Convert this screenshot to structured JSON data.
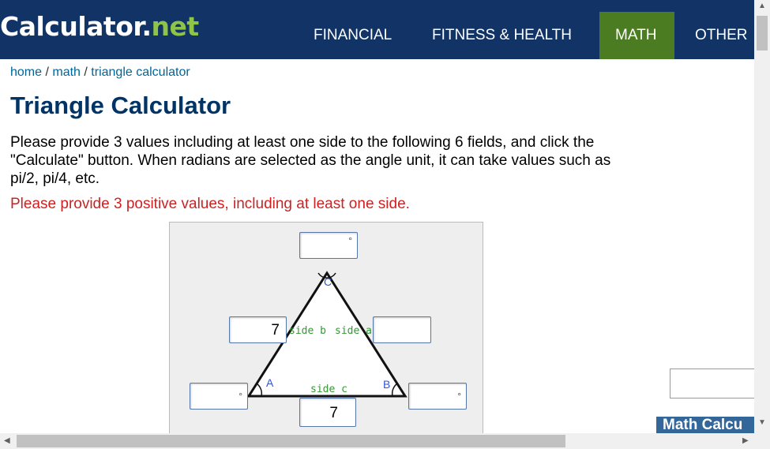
{
  "header": {
    "logo_calc": "Calculator",
    "logo_dot": ".",
    "logo_net": "net",
    "nav": [
      "FINANCIAL",
      "FITNESS & HEALTH",
      "MATH",
      "OTHER"
    ]
  },
  "breadcrumb": {
    "home": "home",
    "sep": " / ",
    "math": "math",
    "current": "triangle calculator"
  },
  "page": {
    "title": "Triangle Calculator",
    "description": "Please provide 3 values including at least one side to the following 6 fields, and click the \"Calculate\" button. When radians are selected as the angle unit, it can take values such as pi/2, pi/4, etc.",
    "error": "Please provide 3 positive values, including at least one side."
  },
  "triangle": {
    "vertex_a": "A",
    "vertex_b": "B",
    "vertex_c": "C",
    "label_side_a": "side a",
    "label_side_b": "side b",
    "label_side_c": "side c",
    "degree_symbol": "°",
    "angle_c_value": "",
    "side_b_value": "7",
    "side_a_value": "",
    "angle_a_value": "",
    "angle_b_value": "",
    "side_c_value": "7"
  },
  "sidebar": {
    "box_title": "Math Calcu"
  },
  "colors": {
    "header_bg": "#113366",
    "active_nav": "#4c7c22",
    "logo_net": "#8ec549",
    "error": "#cc2222",
    "vertex_label": "#3355cc",
    "side_label": "#339933"
  }
}
